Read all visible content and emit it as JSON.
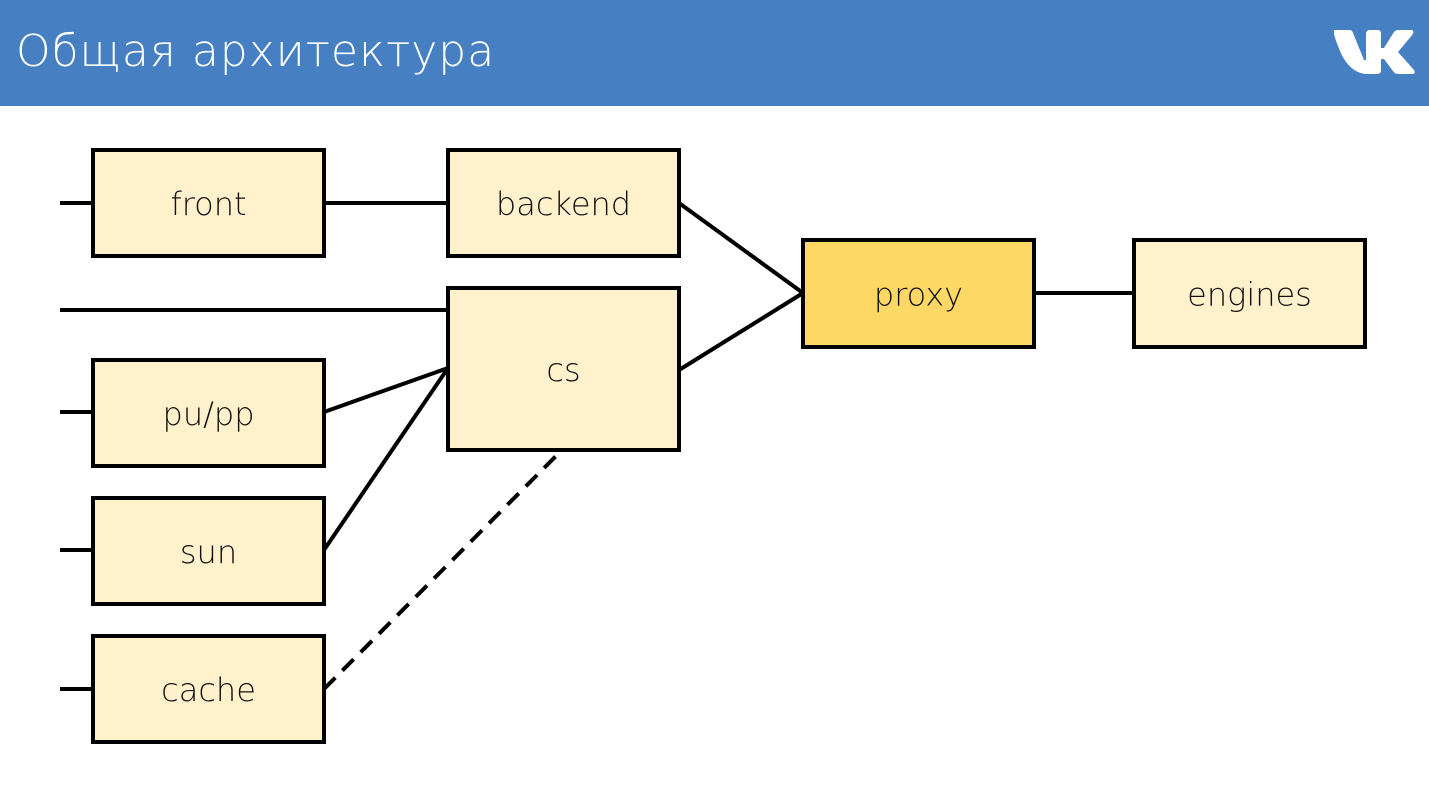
{
  "header": {
    "title": "Общая архитектура",
    "background": "#4680c2",
    "logo": "vk-logo-icon"
  },
  "colors": {
    "node_fill": "#fff1cc",
    "node_highlight_fill": "#fdd865",
    "stroke": "#000000"
  },
  "nodes": [
    {
      "id": "front",
      "label": "front",
      "highlight": false
    },
    {
      "id": "backend",
      "label": "backend",
      "highlight": false
    },
    {
      "id": "cs",
      "label": "cs",
      "highlight": false
    },
    {
      "id": "pupp",
      "label": "pu/pp",
      "highlight": false
    },
    {
      "id": "sun",
      "label": "sun",
      "highlight": false
    },
    {
      "id": "cache",
      "label": "cache",
      "highlight": false
    },
    {
      "id": "proxy",
      "label": "proxy",
      "highlight": true
    },
    {
      "id": "engines",
      "label": "engines",
      "highlight": false
    }
  ],
  "edges": [
    {
      "from": "external",
      "to": "front",
      "style": "solid"
    },
    {
      "from": "front",
      "to": "backend",
      "style": "solid"
    },
    {
      "from": "external",
      "to": "cs",
      "style": "solid"
    },
    {
      "from": "external",
      "to": "pupp",
      "style": "solid"
    },
    {
      "from": "pupp",
      "to": "cs",
      "style": "solid"
    },
    {
      "from": "external",
      "to": "sun",
      "style": "solid"
    },
    {
      "from": "sun",
      "to": "cs",
      "style": "solid"
    },
    {
      "from": "external",
      "to": "cache",
      "style": "solid"
    },
    {
      "from": "cache",
      "to": "cs",
      "style": "dashed"
    },
    {
      "from": "backend",
      "to": "proxy",
      "style": "solid"
    },
    {
      "from": "cs",
      "to": "proxy",
      "style": "solid"
    },
    {
      "from": "proxy",
      "to": "engines",
      "style": "solid"
    }
  ]
}
